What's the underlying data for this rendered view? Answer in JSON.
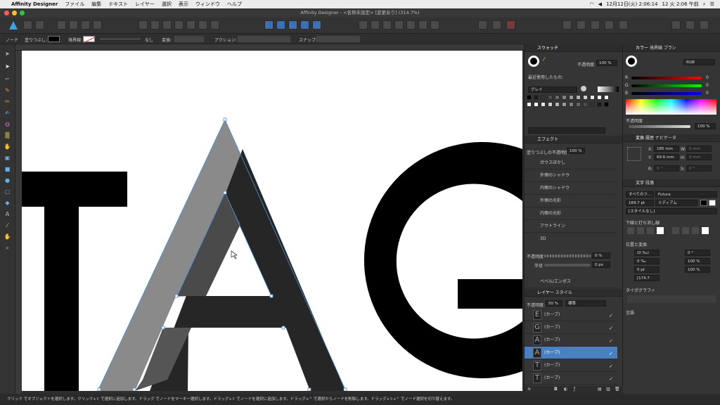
{
  "menubar": {
    "app_name": "Affinity Designer",
    "items": [
      "ファイル",
      "編集",
      "テキスト",
      "レイヤー",
      "選択",
      "表示",
      "ウィンドウ",
      "ヘルプ"
    ],
    "clock_date": "12月12日(火) 2:06:14",
    "clock_time": "12 火 2:06 午前"
  },
  "window": {
    "title": "Affinity Designer - <名称未設定> [変更あり] (314.7%)"
  },
  "context_bar": {
    "mode": "ノード",
    "fill_label": "塗りつぶし:",
    "stroke_label": "境界線:",
    "stroke_none": "なし",
    "transform_label": "変換:",
    "action_label": "アクション:",
    "snap_label": "スナップ:"
  },
  "canvas": {
    "letters": [
      "T",
      "A",
      "G"
    ],
    "colors": {
      "black": "#000000",
      "dark_gray": "#262626",
      "mid_gray": "#555555",
      "light_gray": "#8a8a8a",
      "selection": "#4a90d9"
    }
  },
  "swatches_panel": {
    "tab": "スウォッチ",
    "opacity_label": "不透明度:",
    "opacity_value": "100 %",
    "recent_label": "最近使用したもの:",
    "palette_name": "グレイ"
  },
  "color_panel": {
    "tabs": [
      "カラー",
      "境界線",
      "ブラシ"
    ],
    "mode": "RGB",
    "channels": [
      {
        "name": "R",
        "value": "0"
      },
      {
        "name": "G",
        "value": "0"
      },
      {
        "name": "B",
        "value": "0"
      }
    ],
    "opacity_label": "不透明度",
    "opacity_value": "100 %"
  },
  "transform_panel": {
    "tabs": [
      "変換",
      "履歴",
      "ナビゲータ"
    ],
    "x_label": "X:",
    "x_value": "185 mm",
    "y_label": "Y:",
    "y_value": "69.6 mm",
    "w_label": "W:",
    "w_value": "0 mm",
    "h_label": "H:",
    "h_value": "0 mm",
    "r_label": "R:",
    "r_value": "0 °",
    "s_label": "S:",
    "s_value": "0 °"
  },
  "effects_panel": {
    "tab": "エフェクト",
    "fill_opacity_label": "塗りつぶしの不透明度:",
    "fill_opacity_value": "100 %",
    "effects": [
      "ガウスぼかし",
      "外側のシャドウ",
      "内側のシャドウ",
      "外側の光彩",
      "内側の光彩",
      "アウトライン",
      "3D",
      "ベベル/エンボス"
    ],
    "opacity_label": "不透明度",
    "opacity_value": "0 %",
    "radius_label": "半径",
    "radius_value": "0 px"
  },
  "text_panel": {
    "tabs": [
      "文字",
      "段落"
    ],
    "all_fonts": "すべてのフ...",
    "font_name": "Futura",
    "font_size": "169.7 pt",
    "font_weight": "ミディアム",
    "style": "[スタイルなし]",
    "underline_label": "下線と打ち消し線",
    "position_label": "位置と変換",
    "pos_values": [
      "(0 ‰)",
      "0 °",
      "0 ‰",
      "100 %",
      "0 pt",
      "100 %",
      "[174.7"
    ],
    "typography_label": "タイポグラフィ",
    "language_label": "言語"
  },
  "layers_panel": {
    "tabs": [
      "レイヤー",
      "スタイル"
    ],
    "opacity_label": "不透明度:",
    "opacity_value": "50 %",
    "blend_mode": "標準",
    "layers": [
      {
        "glyph": "E",
        "name": "(カーブ)"
      },
      {
        "glyph": "G",
        "name": "(カーブ)"
      },
      {
        "glyph": "A",
        "name": "(カーブ)"
      },
      {
        "glyph": "A",
        "name": "(カーブ)",
        "selected": true
      },
      {
        "glyph": "T",
        "name": "(カーブ)"
      },
      {
        "glyph": "T",
        "name": "(カーブ)"
      }
    ]
  },
  "statusbar": {
    "text": "クリック でオブジェクトを選択します。クリック+⇧ で選択に追加します。ドラッグ でノードをマーキー選択します。ドラッグ+⇧ でノードを選択に追加します。ドラッグ+^ で選択からノードを削除します。ドラッグ+⇧+^ でノード選択を切り替えます。"
  }
}
